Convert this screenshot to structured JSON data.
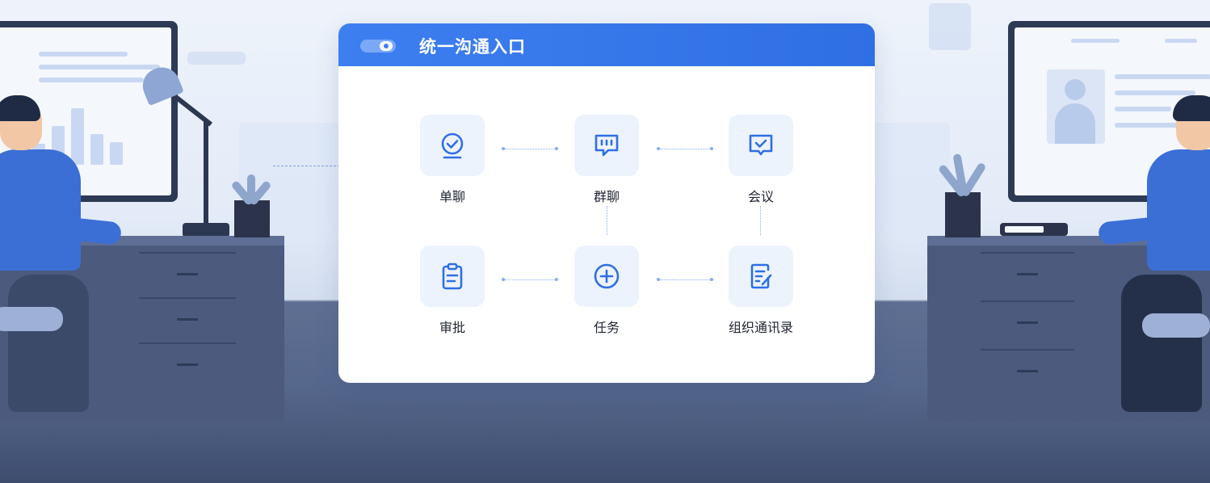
{
  "card": {
    "title": "统一沟通入口",
    "features": [
      {
        "id": "single-chat",
        "label": "单聊",
        "icon": "chat-bubble-check-icon"
      },
      {
        "id": "group-chat",
        "label": "群聊",
        "icon": "group-chat-icon"
      },
      {
        "id": "meeting",
        "label": "会议",
        "icon": "meeting-icon"
      },
      {
        "id": "approval",
        "label": "审批",
        "icon": "clipboard-icon"
      },
      {
        "id": "task",
        "label": "任务",
        "icon": "plus-circle-icon"
      },
      {
        "id": "directory",
        "label": "组织通讯录",
        "icon": "edit-document-icon"
      }
    ]
  },
  "colors": {
    "accent": "#2f6fe4",
    "icon_tile": "#edf3fd",
    "icon_stroke": "#2f6fe4"
  }
}
